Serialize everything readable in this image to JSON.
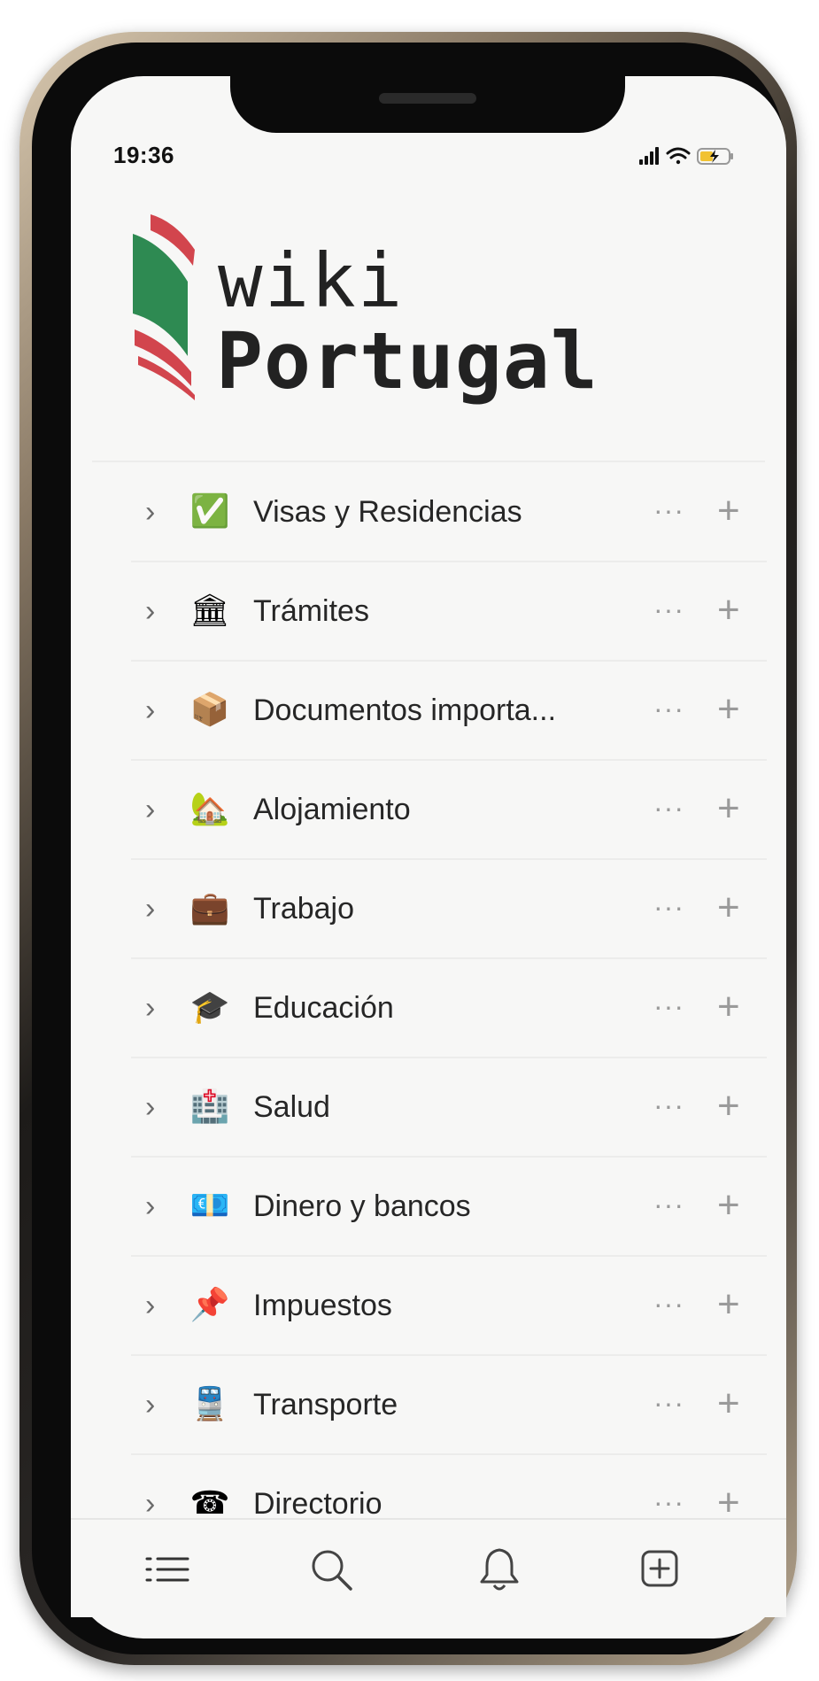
{
  "status_bar": {
    "time": "19:36",
    "icons": [
      "signal-icon",
      "wifi-icon",
      "battery-charging-icon"
    ]
  },
  "logo": {
    "line1": "wiki",
    "line2": "Portugal",
    "colors": {
      "red": "#d2454d",
      "green": "#2e8a52",
      "text": "#222222"
    }
  },
  "menu": {
    "items": [
      {
        "label": "Visas y Residencias",
        "emoji": "✅",
        "icon": "check-box-icon"
      },
      {
        "label": "Trámites",
        "emoji": "🏛",
        "icon": "classical-building-icon"
      },
      {
        "label": "Documentos importa...",
        "emoji": "📦",
        "icon": "package-icon"
      },
      {
        "label": "Alojamiento",
        "emoji": "🏡",
        "icon": "house-icon"
      },
      {
        "label": "Trabajo",
        "emoji": "💼",
        "icon": "briefcase-icon"
      },
      {
        "label": "Educación",
        "emoji": "🎓",
        "icon": "graduation-cap-icon"
      },
      {
        "label": "Salud",
        "emoji": "🏥",
        "icon": "hospital-icon"
      },
      {
        "label": "Dinero y bancos",
        "emoji": "💶",
        "icon": "euro-banknote-icon"
      },
      {
        "label": "Impuestos",
        "emoji": "📌",
        "icon": "pushpin-icon"
      },
      {
        "label": "Transporte",
        "emoji": "🚆",
        "icon": "train-icon"
      },
      {
        "label": "Directorio",
        "emoji": "☎",
        "icon": "telephone-icon"
      }
    ],
    "chevron": "›",
    "more": "···",
    "add": "+"
  },
  "tabbar": {
    "tabs": [
      "list-icon",
      "search-icon",
      "bell-icon",
      "add-page-icon"
    ]
  }
}
